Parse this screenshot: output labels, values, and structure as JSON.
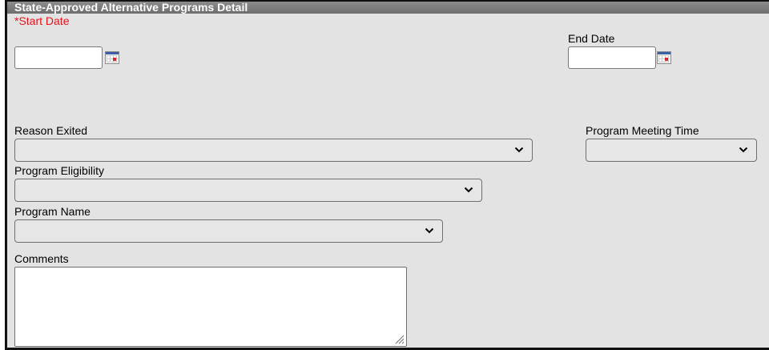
{
  "panel": {
    "title": "State-Approved Alternative Programs Detail"
  },
  "fields": {
    "start_date": {
      "required_mark": "*",
      "label": "Start Date",
      "value": ""
    },
    "end_date": {
      "label": "End Date",
      "value": ""
    },
    "reason_exited": {
      "label": "Reason Exited",
      "selected": ""
    },
    "program_meeting_time": {
      "label": "Program Meeting Time",
      "selected": ""
    },
    "program_eligibility": {
      "label": "Program Eligibility",
      "selected": ""
    },
    "program_name": {
      "label": "Program Name",
      "selected": ""
    },
    "comments": {
      "label": "Comments",
      "value": ""
    }
  },
  "icons": {
    "calendar": "calendar-icon",
    "dropdown": "chevron-down-icon",
    "resize": "resize-grip-icon"
  },
  "colors": {
    "required": "#e4141b",
    "header_bg": "#7d7d7d",
    "panel_bg": "#e3e3e3"
  }
}
